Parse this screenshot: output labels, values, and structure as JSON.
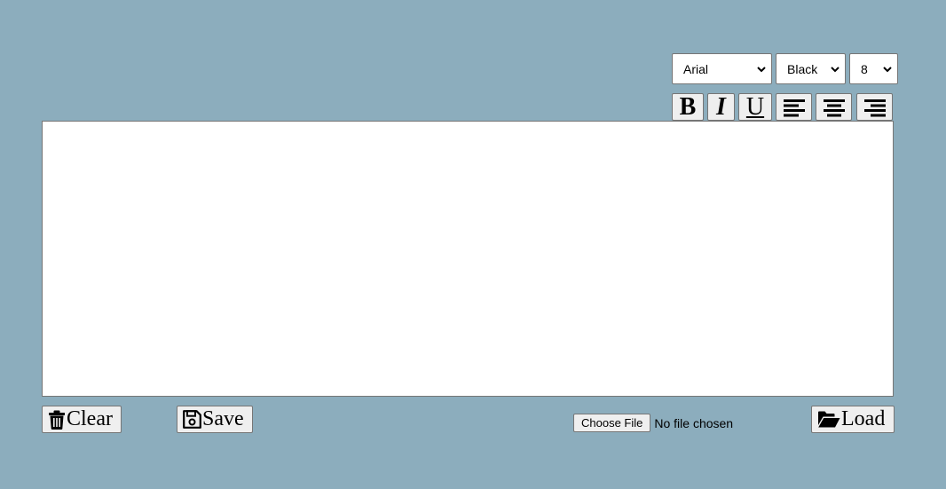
{
  "toolbar": {
    "font_family": {
      "selected": "Arial"
    },
    "font_color": {
      "selected": "Black"
    },
    "font_size": {
      "selected": "8"
    },
    "bold_label": "B",
    "italic_label": "I",
    "underline_label": "U"
  },
  "editor": {
    "content": ""
  },
  "actions": {
    "clear_label": "Clear",
    "save_label": "Save",
    "choose_file_label": "Choose File",
    "file_status": "No file chosen",
    "load_label": "Load"
  },
  "colors": {
    "background": "#8cadbd",
    "button_face": "#efefef",
    "border": "#767676",
    "editor_bg": "#ffffff"
  },
  "icons": {
    "clear": "trash-icon",
    "save": "floppy-disk-icon",
    "load": "folder-open-icon",
    "align_left": "align-left-icon",
    "align_center": "align-center-icon",
    "align_right": "align-right-icon"
  }
}
